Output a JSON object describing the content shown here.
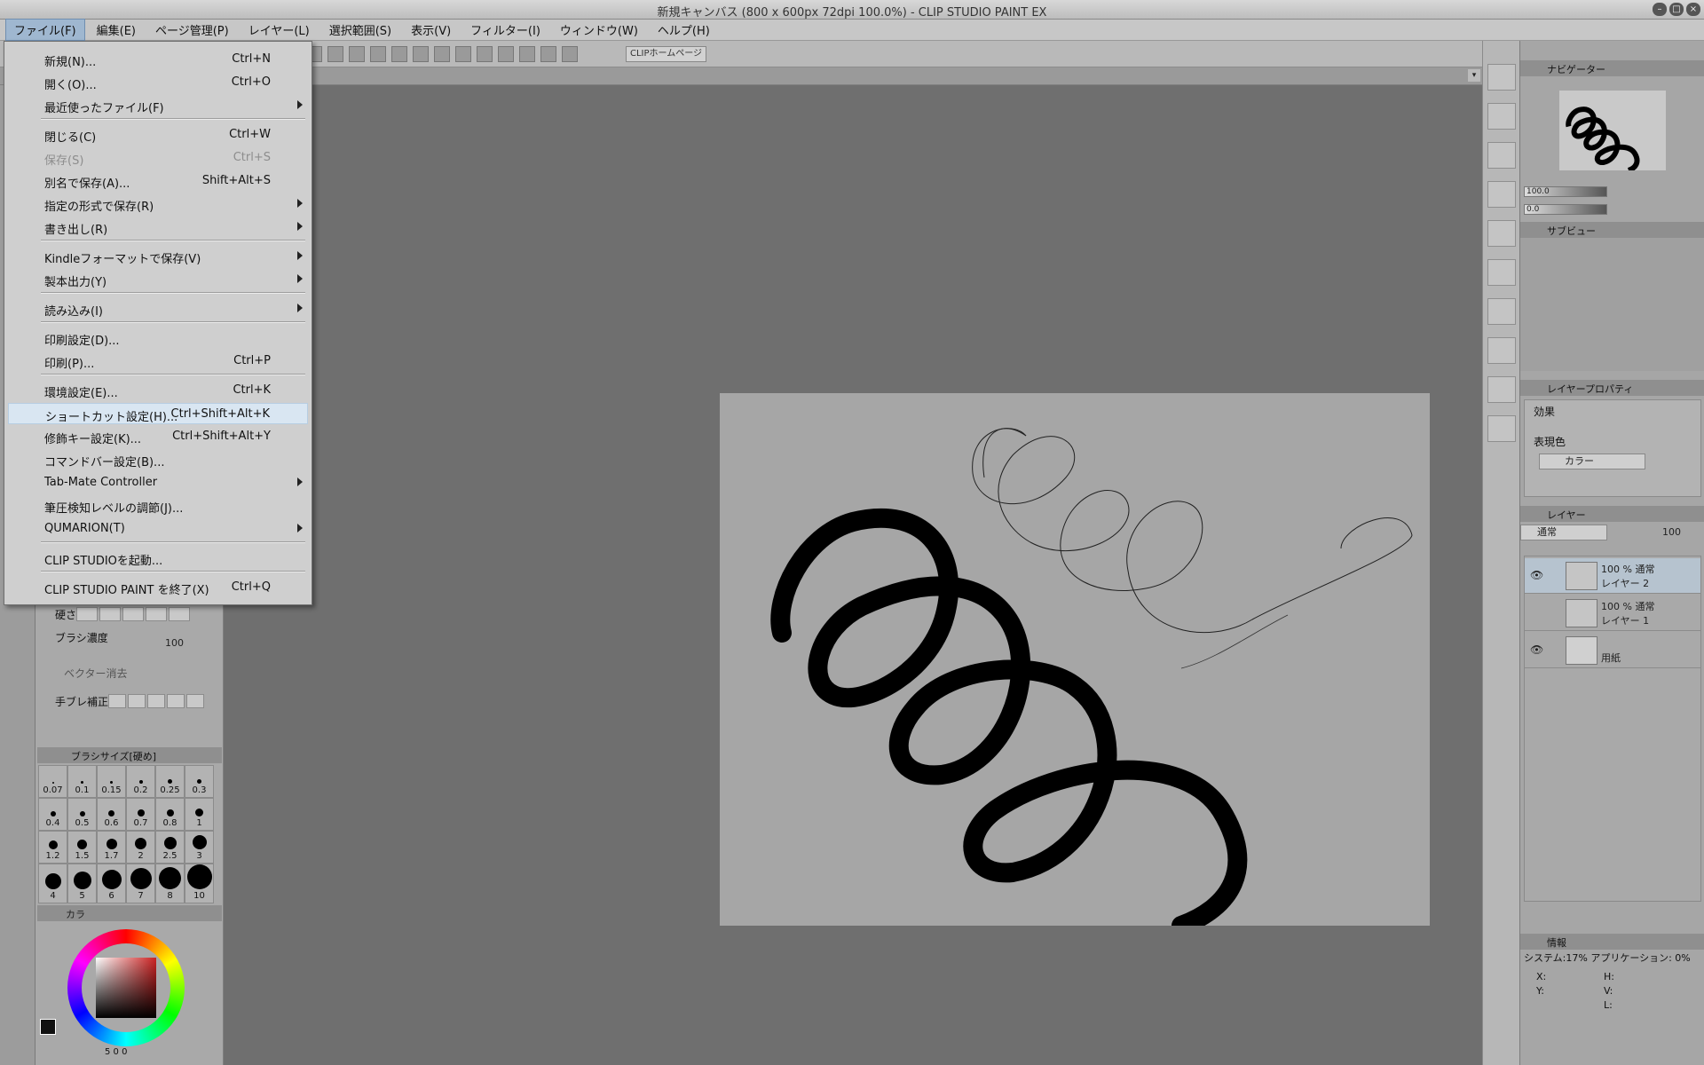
{
  "window": {
    "title": "新規キャンバス (800 x 600px 72dpi 100.0%)  - CLIP STUDIO PAINT EX"
  },
  "menubar": [
    "ファイル(F)",
    "編集(E)",
    "ページ管理(P)",
    "レイヤー(L)",
    "選択範囲(S)",
    "表示(V)",
    "フィルター(I)",
    "ウィンドウ(W)",
    "ヘルプ(H)"
  ],
  "cmdbar": {
    "home_label": "CLIPホームページ"
  },
  "file_menu": {
    "items": [
      {
        "label": "新規(N)...",
        "shortcut": "Ctrl+N"
      },
      {
        "label": "開く(O)...",
        "shortcut": "Ctrl+O"
      },
      {
        "label": "最近使ったファイル(F)",
        "shortcut": ""
      },
      {
        "label": "閉じる(C)",
        "shortcut": "Ctrl+W"
      },
      {
        "label": "保存(S)",
        "shortcut": "Ctrl+S"
      },
      {
        "label": "別名で保存(A)...",
        "shortcut": "Shift+Alt+S"
      },
      {
        "label": "指定の形式で保存(R)",
        "shortcut": ""
      },
      {
        "label": "書き出し(R)",
        "shortcut": ""
      },
      {
        "label": "Kindleフォーマットで保存(V)",
        "shortcut": ""
      },
      {
        "label": "製本出力(Y)",
        "shortcut": ""
      },
      {
        "label": "読み込み(I)",
        "shortcut": ""
      },
      {
        "label": "印刷設定(D)...",
        "shortcut": ""
      },
      {
        "label": "印刷(P)...",
        "shortcut": "Ctrl+P"
      },
      {
        "label": "環境設定(E)...",
        "shortcut": "Ctrl+K"
      },
      {
        "label": "ショートカット設定(H)...",
        "shortcut": "Ctrl+Shift+Alt+K"
      },
      {
        "label": "修飾キー設定(K)...",
        "shortcut": "Ctrl+Shift+Alt+Y"
      },
      {
        "label": "コマンドバー設定(B)...",
        "shortcut": ""
      },
      {
        "label": "Tab-Mate Controller",
        "shortcut": ""
      },
      {
        "label": "筆圧検知レベルの調節(J)...",
        "shortcut": ""
      },
      {
        "label": "QUMARION(T)",
        "shortcut": ""
      },
      {
        "label": "CLIP STUDIOを起動...",
        "shortcut": ""
      },
      {
        "label": "CLIP STUDIO PAINT を終了(X)",
        "shortcut": "Ctrl+Q"
      }
    ]
  },
  "tool_property": {
    "hardness_label": "硬さ",
    "density_label": "ブラシ濃度",
    "density_value": "100",
    "vector_erase_label": "ベクター消去",
    "stabilization_label": "手ブレ補正"
  },
  "brush_size": {
    "header": "ブラシサイズ[硬め]",
    "sizes": [
      "0.07",
      "0.1",
      "0.15",
      "0.2",
      "0.25",
      "0.3",
      "0.4",
      "0.5",
      "0.6",
      "0.7",
      "0.8",
      "1",
      "1.2",
      "1.5",
      "1.7",
      "2",
      "2.5",
      "3",
      "4",
      "5",
      "6",
      "7",
      "8",
      "10"
    ]
  },
  "color_panel": {
    "header": "カラ",
    "footer": "5  0  0"
  },
  "navigator": {
    "header": "ナビゲーター",
    "zoom": "100.0",
    "rotate": "0.0"
  },
  "subview": {
    "header": "サブビュー"
  },
  "layer_property": {
    "header": "レイヤープロパティ",
    "effect_label": "効果",
    "expression_label": "表現色",
    "expression_value": "カラー"
  },
  "layer_panel": {
    "header": "レイヤー",
    "blend_mode": "通常",
    "opacity": "100",
    "layers": [
      {
        "top": "100 % 通常",
        "name": "レイヤー 2"
      },
      {
        "top": "100 % 通常",
        "name": "レイヤー 1"
      },
      {
        "top": "",
        "name": "用紙"
      }
    ]
  },
  "info_panel": {
    "header": "情報",
    "text": "システム:17%  アプリケーション: 0%",
    "x_label": "X:",
    "y_label": "Y:",
    "h_label": "H:",
    "v_label": "V:",
    "l_label": "L:"
  }
}
